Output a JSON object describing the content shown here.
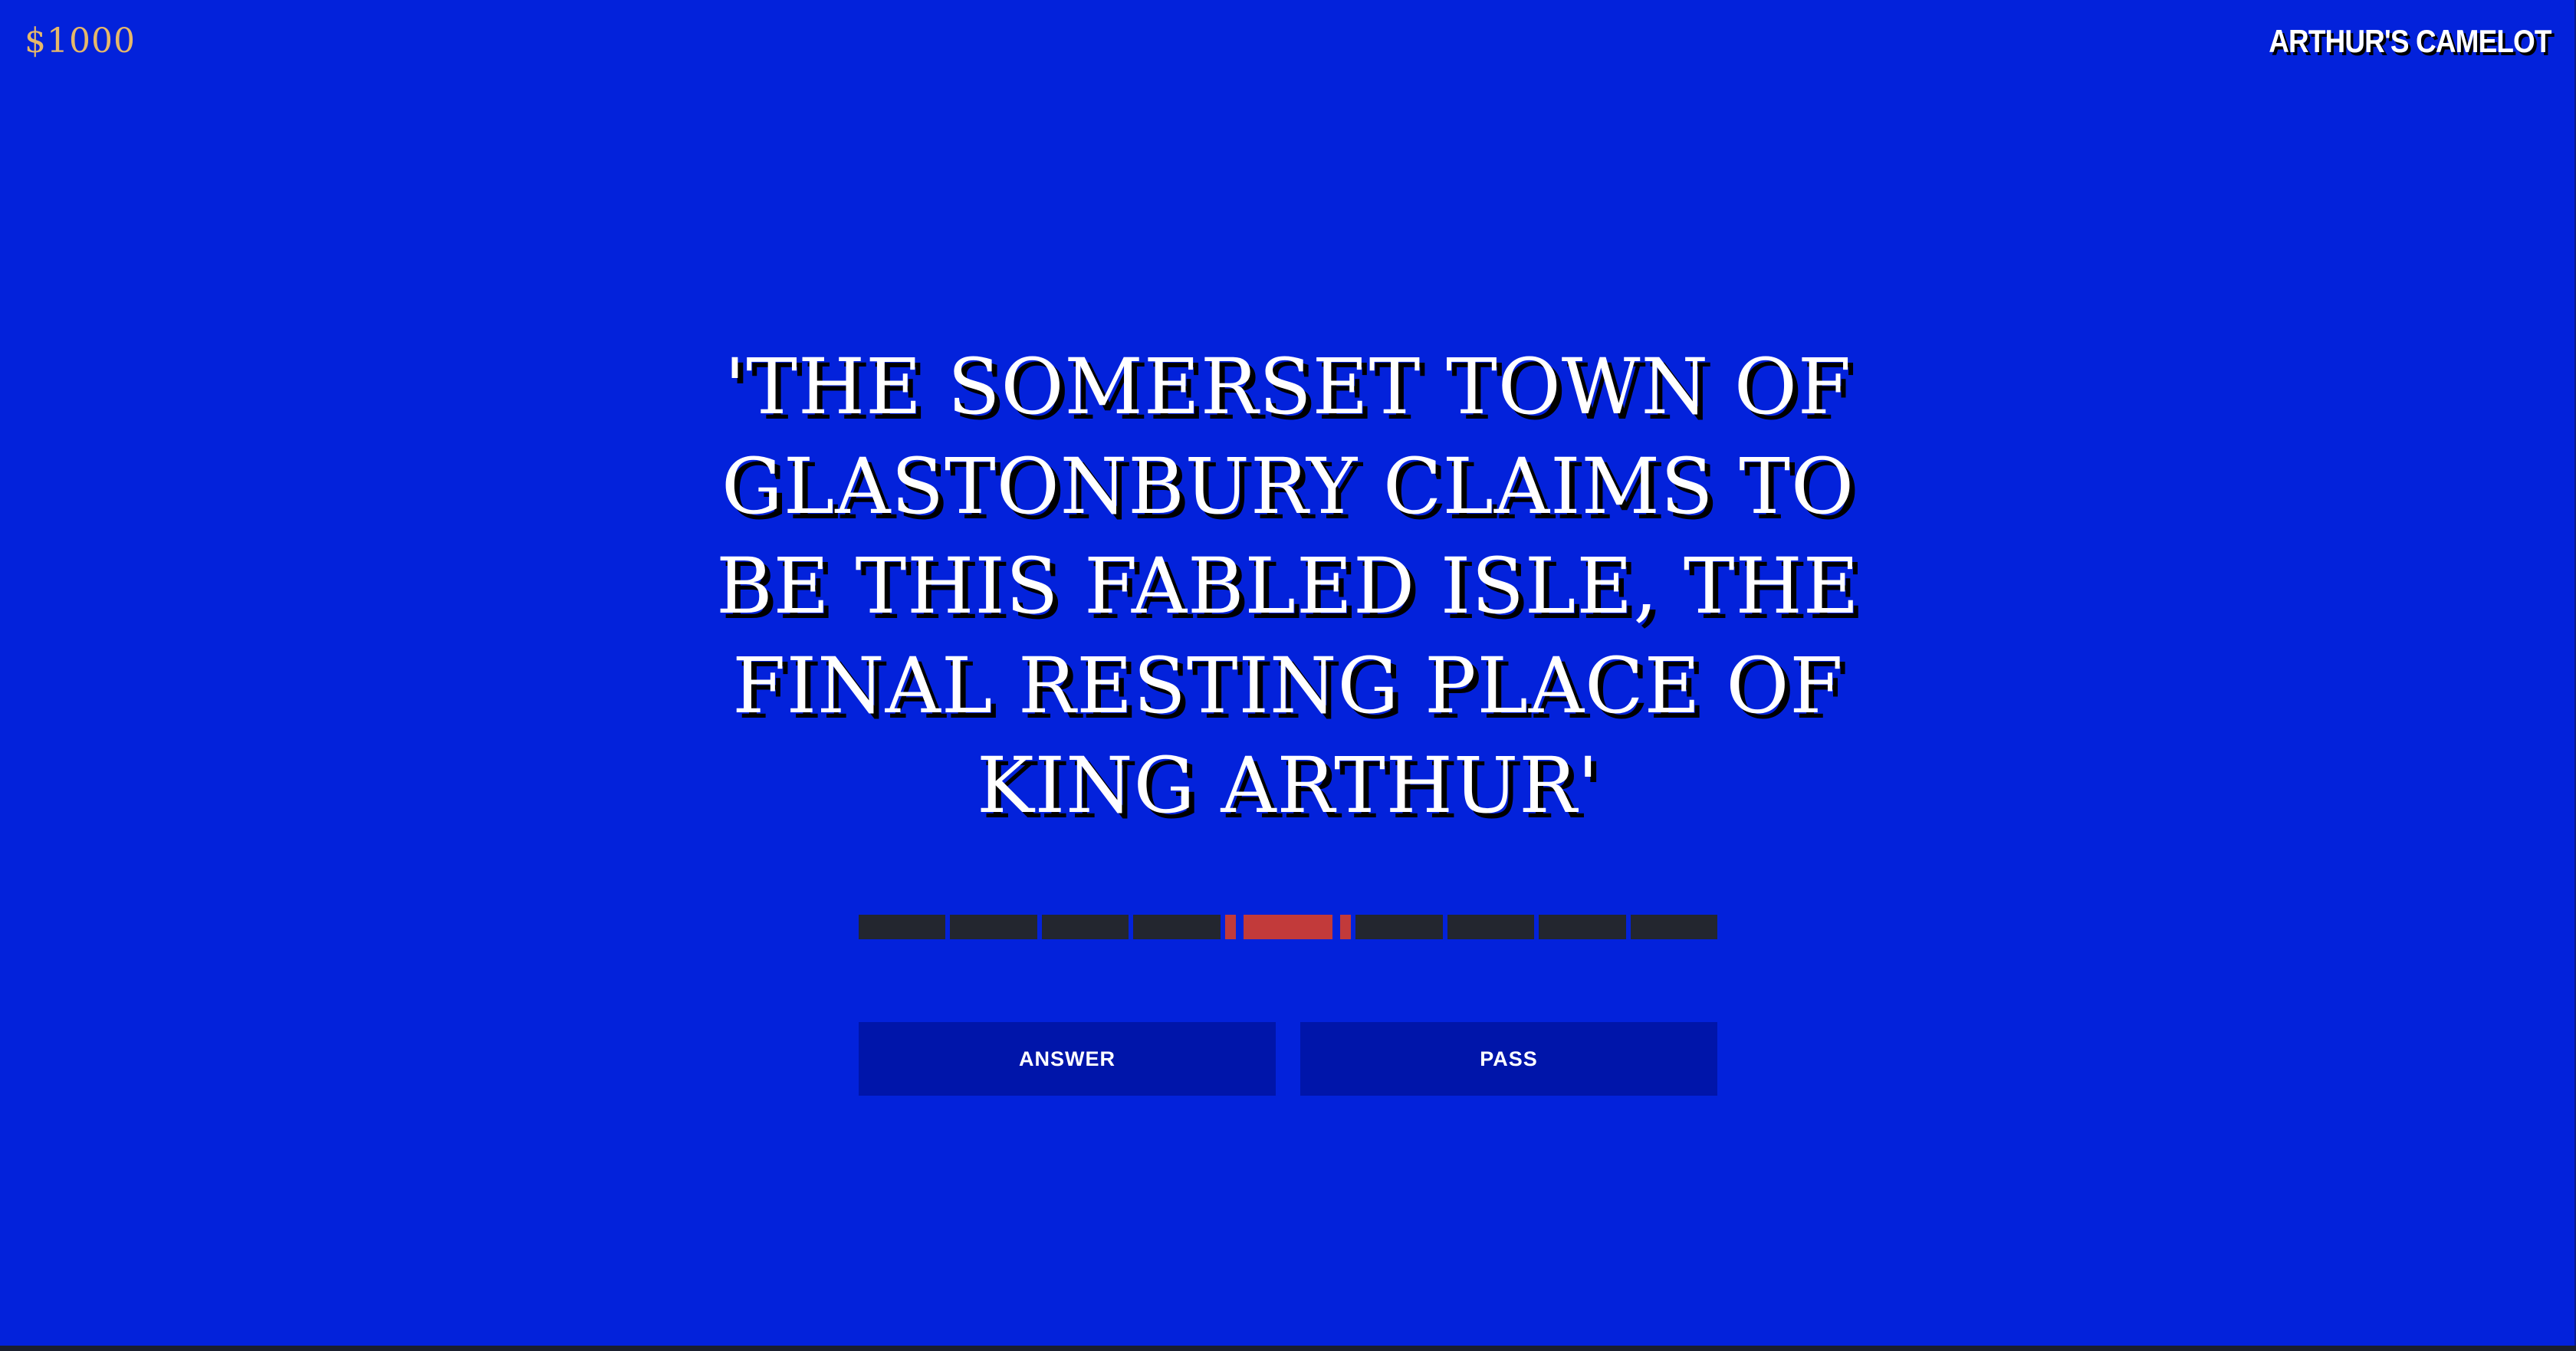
{
  "header": {
    "value": "$1000",
    "category": "ARTHUR'S CAMELOT"
  },
  "clue": {
    "text": "'THE SOMERSET TOWN OF GLASTONBURY CLAIMS TO BE THIS FABLED ISLE, THE FINAL RESTING PLACE OF KING ARTHUR'"
  },
  "timer": {
    "segments_total": 9,
    "segments_remaining": 1
  },
  "actions": {
    "answer_label": "ANSWER",
    "pass_label": "PASS"
  },
  "colors": {
    "background": "#0322db",
    "value_text": "#e6b86a",
    "button": "#0015aa",
    "timer_off": "#23262f",
    "timer_on": "#c23a3a"
  }
}
